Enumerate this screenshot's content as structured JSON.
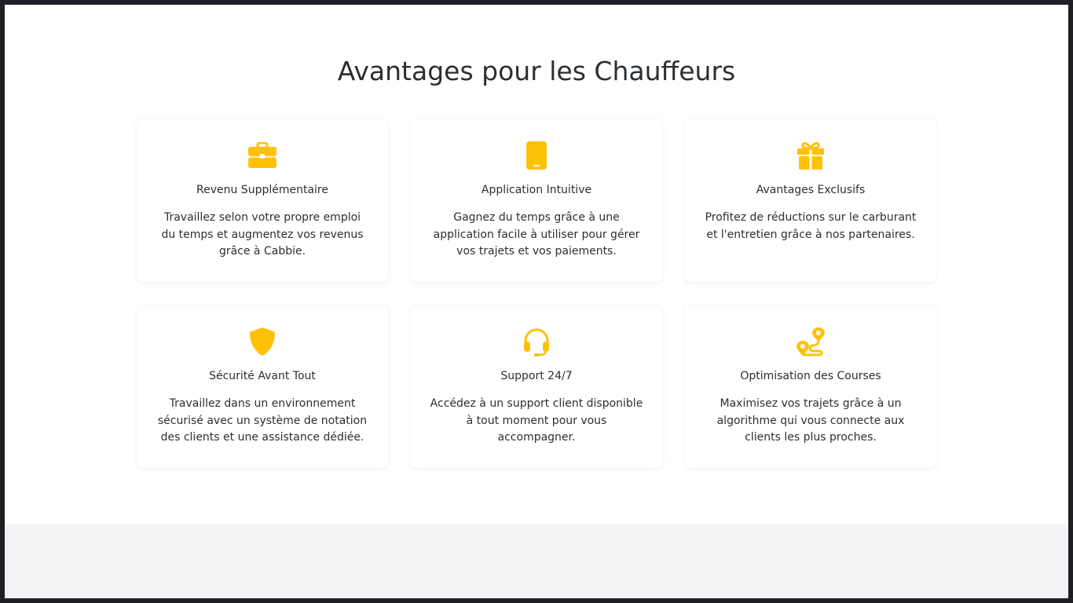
{
  "section": {
    "title": "Avantages pour les Chauffeurs"
  },
  "colors": {
    "accent": "#FFC107",
    "text": "#2B2F33",
    "background": "#FFFFFF",
    "footer": "#F2F3F5"
  },
  "cards": [
    {
      "icon": "briefcase-icon",
      "title": "Revenu Supplémentaire",
      "text": "Travaillez selon votre propre emploi du temps et augmentez vos revenus grâce à Cabbie."
    },
    {
      "icon": "tablet-icon",
      "title": "Application Intuitive",
      "text": "Gagnez du temps grâce à une application facile à utiliser pour gérer vos trajets et vos paiements."
    },
    {
      "icon": "gift-icon",
      "title": "Avantages Exclusifs",
      "text": "Profitez de réductions sur le carburant et l'entretien grâce à nos partenaires."
    },
    {
      "icon": "shield-icon",
      "title": "Sécurité Avant Tout",
      "text": "Travaillez dans un environnement sécurisé avec un système de notation des clients et une assistance dédiée."
    },
    {
      "icon": "headset-icon",
      "title": "Support 24/7",
      "text": "Accédez à un support client disponible à tout moment pour vous accompagner."
    },
    {
      "icon": "route-icon",
      "title": "Optimisation des Courses",
      "text": "Maximisez vos trajets grâce à un algorithme qui vous connecte aux clients les plus proches."
    }
  ]
}
